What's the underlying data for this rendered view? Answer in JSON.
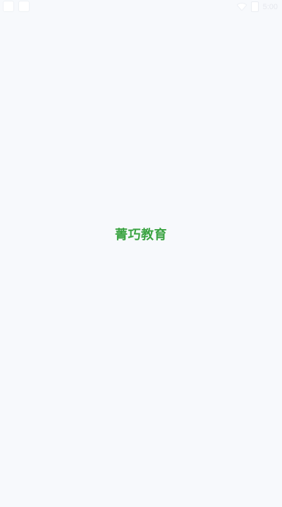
{
  "status_bar": {
    "time": "5:00"
  },
  "splash": {
    "title": "菁巧教育",
    "title_color": "#3aa341"
  },
  "icons": {
    "left_1": "notification-square-icon",
    "left_2": "notification-square-icon",
    "wifi": "wifi-icon",
    "battery": "battery-icon"
  },
  "colors": {
    "background": "#f7f9fc"
  }
}
